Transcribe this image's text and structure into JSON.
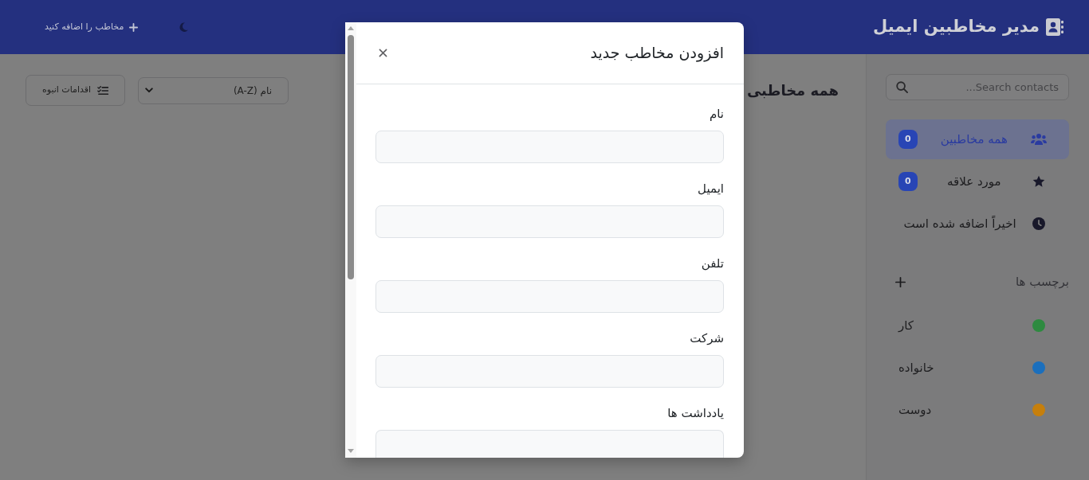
{
  "navbar": {
    "brand": "مدیر مخاطبین ایمیل",
    "add_contact": "مخاطب را اضافه کنید"
  },
  "sidebar": {
    "search": {
      "placeholder": "Search contacts..."
    },
    "items": [
      {
        "label": "همه مخاطبین",
        "count": "0",
        "selected": true
      },
      {
        "label": "مورد علاقه",
        "count": "0",
        "selected": false
      },
      {
        "label": "اخیراً اضافه شده است",
        "selected": false
      }
    ],
    "tags_heading": "برچسب ها",
    "tags": [
      {
        "label": "کار",
        "color": "#2e8a40"
      },
      {
        "label": "خانواده",
        "color": "#1b6fbd"
      },
      {
        "label": "دوست",
        "color": "#c67f0c"
      }
    ]
  },
  "main": {
    "heading": "همه مخاطبی",
    "sort": "نام (A-Z)",
    "bulk_actions": "اقدامات انبوه"
  },
  "modal": {
    "title": "افزودن مخاطب جدید",
    "fields": [
      {
        "label": "نام",
        "kind": "text"
      },
      {
        "label": "ایمیل",
        "kind": "text"
      },
      {
        "label": "تلفن",
        "kind": "text"
      },
      {
        "label": "شرکت",
        "kind": "text"
      },
      {
        "label": "یادداشت ها",
        "kind": "textarea"
      }
    ]
  }
}
